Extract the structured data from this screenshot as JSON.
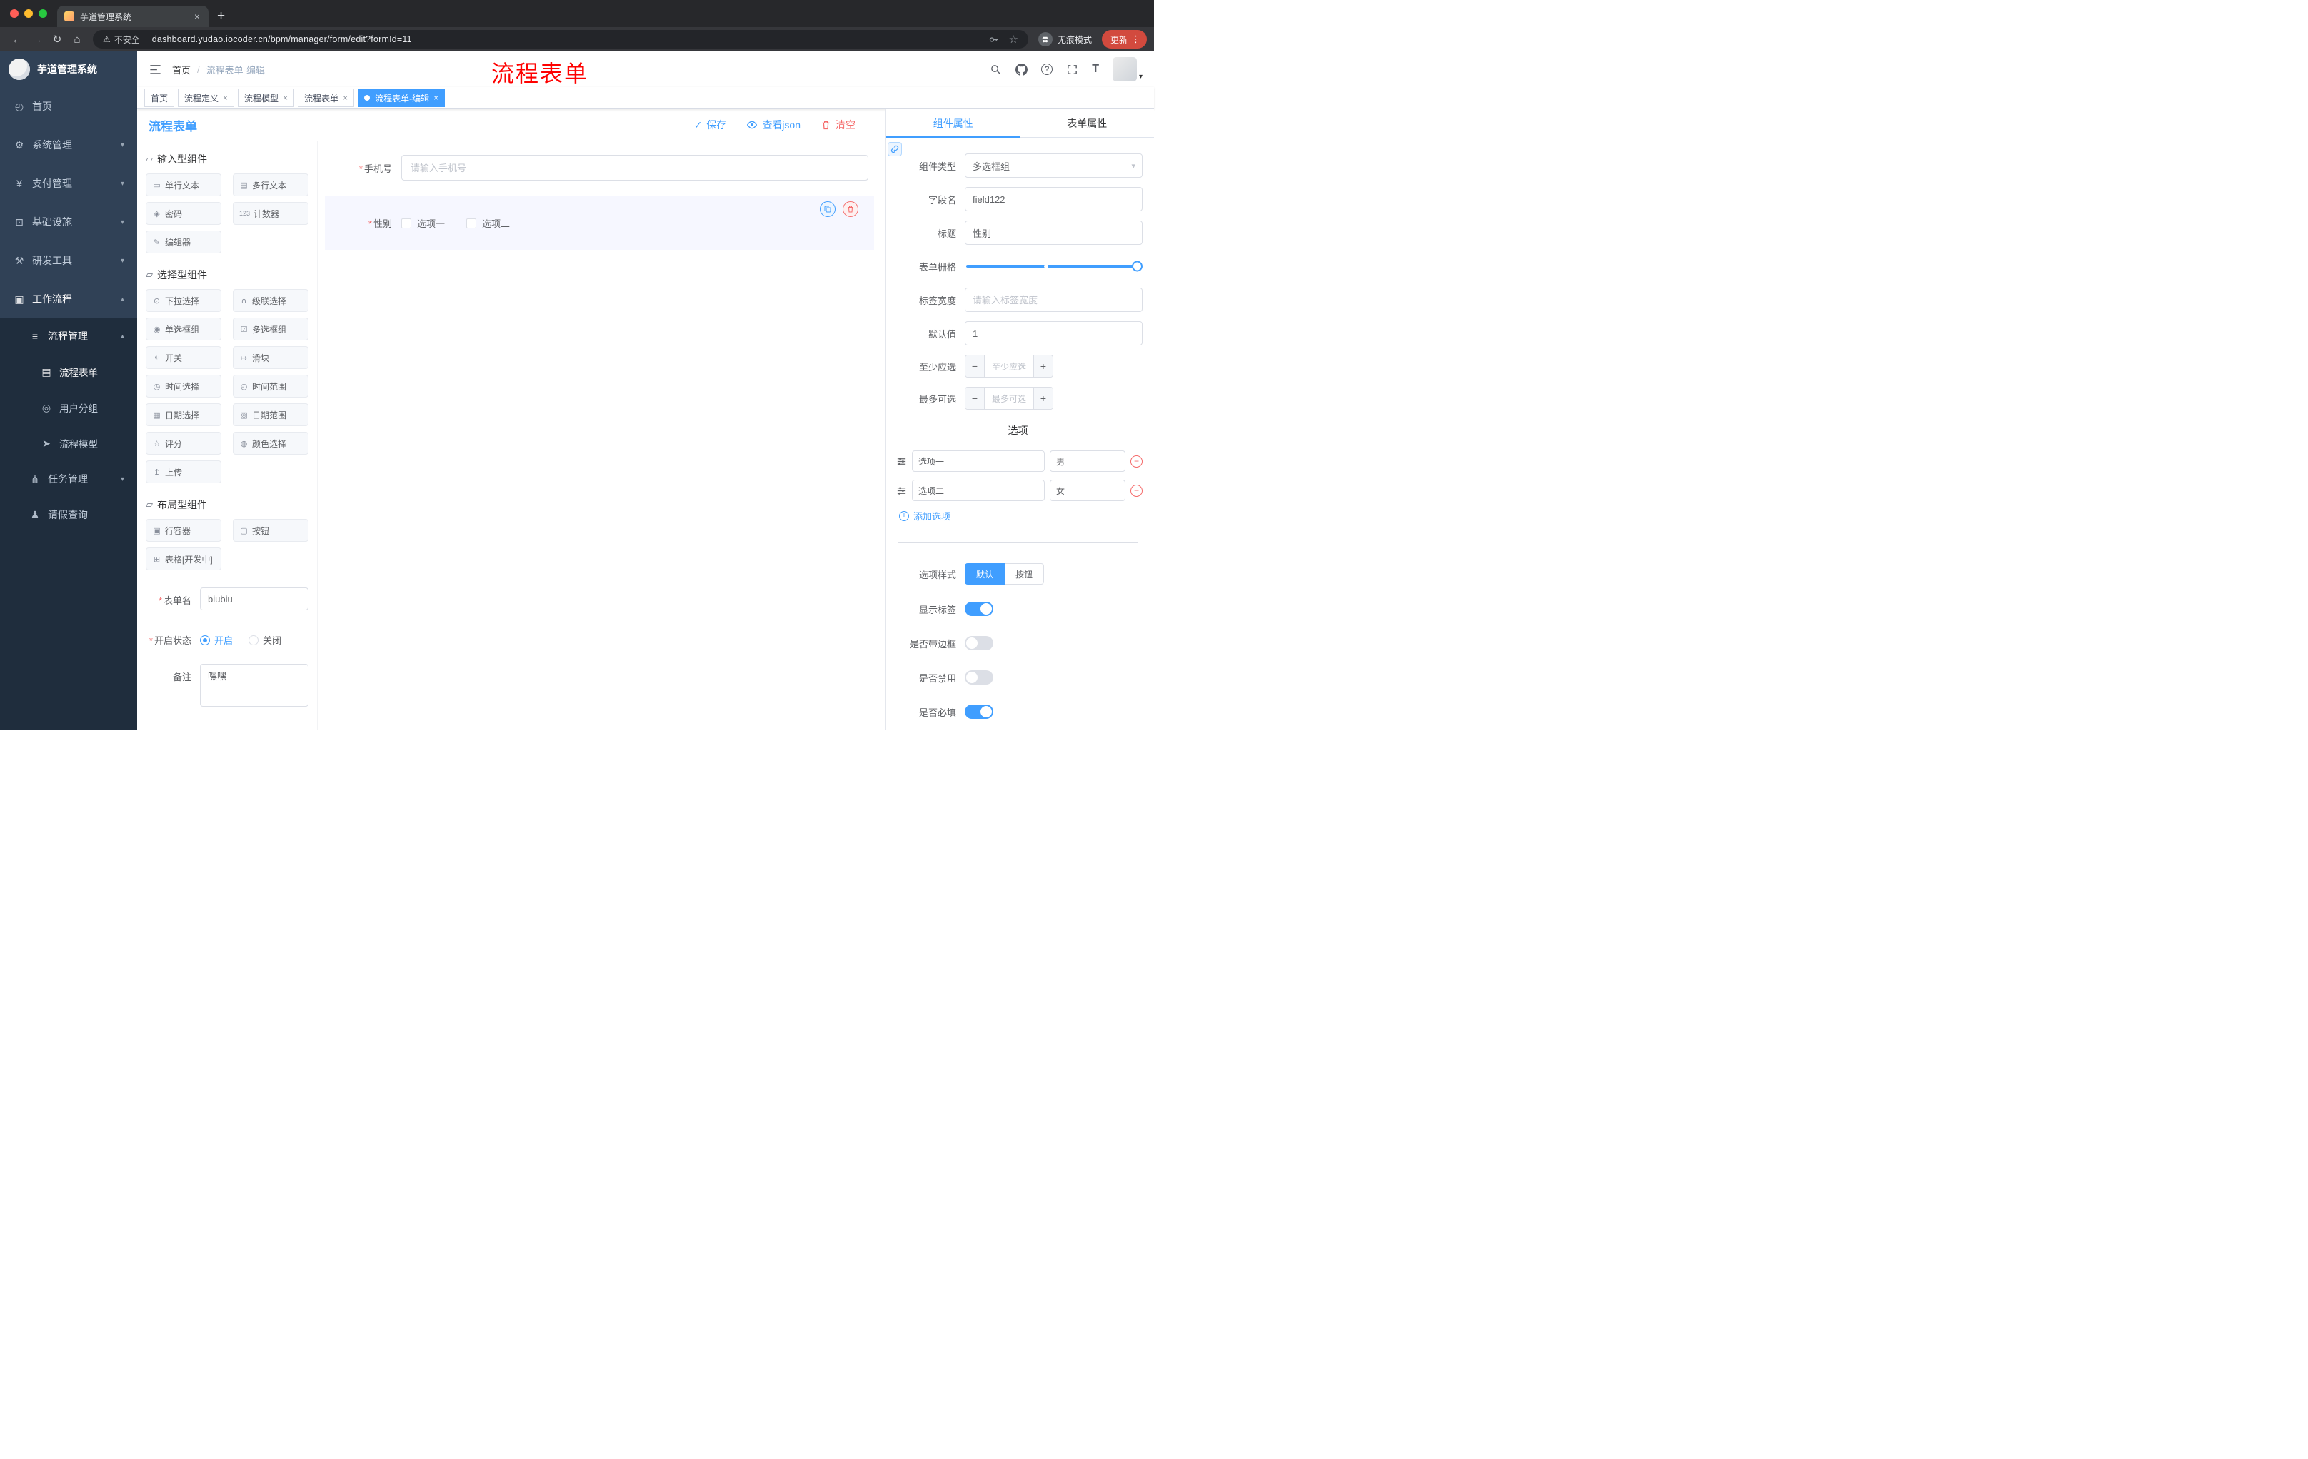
{
  "browser": {
    "tab_title": "芋道管理系统",
    "security_label": "不安全",
    "url": "dashboard.yudao.iocoder.cn/bpm/manager/form/edit?formId=11",
    "incognito_label": "无痕模式",
    "update_label": "更新"
  },
  "glyphs": {
    "close": "×",
    "new_tab": "+",
    "back": "←",
    "forward": "→",
    "reload": "↻",
    "home": "⌂",
    "warn": "⚠",
    "star": "☆",
    "dots": "⋮",
    "caret": "▾",
    "chev_down": "▾",
    "chev_up": "▴",
    "check": "✓",
    "slash": "/",
    "question": "?",
    "font_size": "T",
    "minus": "−",
    "plus": "+",
    "required": "*"
  },
  "annotation_text": "流程表单",
  "sidebar": {
    "logo_title": "芋道管理系统",
    "items": [
      {
        "label": "首页",
        "icon": "◴"
      },
      {
        "label": "系统管理",
        "icon": "⚙"
      },
      {
        "label": "支付管理",
        "icon": "¥"
      },
      {
        "label": "基础设施",
        "icon": "⊡"
      },
      {
        "label": "研发工具",
        "icon": "⚒"
      },
      {
        "label": "工作流程",
        "icon": "▣"
      },
      {
        "label": "流程管理",
        "icon": "≡"
      },
      {
        "label": "流程表单",
        "icon": "▤"
      },
      {
        "label": "用户分组",
        "icon": "◎"
      },
      {
        "label": "流程模型",
        "icon": "➤"
      },
      {
        "label": "任务管理",
        "icon": "⋔"
      },
      {
        "label": "请假查询",
        "icon": "♟"
      }
    ]
  },
  "header": {
    "breadcrumb_home": "首页",
    "breadcrumb_current": "流程表单-编辑"
  },
  "tags": [
    {
      "label": "首页"
    },
    {
      "label": "流程定义"
    },
    {
      "label": "流程模型"
    },
    {
      "label": "流程表单"
    },
    {
      "label": "流程表单-编辑"
    }
  ],
  "page": {
    "title": "流程表单",
    "save": "保存",
    "view_json": "查看json",
    "clear": "清空"
  },
  "components": {
    "groups": [
      {
        "title": "输入型组件",
        "items": [
          {
            "label": "单行文本",
            "icon": "▭"
          },
          {
            "label": "多行文本",
            "icon": "▤"
          },
          {
            "label": "密码",
            "icon": "◈"
          },
          {
            "label": "计数器",
            "icon": "123"
          },
          {
            "label": "编辑器",
            "icon": "✎"
          }
        ]
      },
      {
        "title": "选择型组件",
        "items": [
          {
            "label": "下拉选择",
            "icon": "⊙"
          },
          {
            "label": "级联选择",
            "icon": "⋔"
          },
          {
            "label": "单选框组",
            "icon": "◉"
          },
          {
            "label": "多选框组",
            "icon": "☑"
          },
          {
            "label": "开关",
            "icon": "◐"
          },
          {
            "label": "滑块",
            "icon": "↦"
          },
          {
            "label": "时间选择",
            "icon": "◷"
          },
          {
            "label": "时间范围",
            "icon": "◴"
          },
          {
            "label": "日期选择",
            "icon": "▦"
          },
          {
            "label": "日期范围",
            "icon": "▧"
          },
          {
            "label": "评分",
            "icon": "☆"
          },
          {
            "label": "颜色选择",
            "icon": "◍"
          },
          {
            "label": "上传",
            "icon": "↥"
          }
        ]
      },
      {
        "title": "布局型组件",
        "items": [
          {
            "label": "行容器",
            "icon": "▣"
          },
          {
            "label": "按钮",
            "icon": "▢"
          },
          {
            "label": "表格[开发中]",
            "icon": "⊞"
          }
        ]
      }
    ],
    "form": {
      "name_label": "表单名",
      "name_value": "biubiu",
      "status_label": "开启状态",
      "status_on": "开启",
      "status_off": "关闭",
      "remark_label": "备注",
      "remark_value": "嘿嘿"
    }
  },
  "canvas": {
    "phone": {
      "label": "手机号",
      "placeholder": "请输入手机号"
    },
    "gender": {
      "label": "性别",
      "option1": "选项一",
      "option2": "选项二"
    }
  },
  "props": {
    "tab_component": "组件属性",
    "tab_form": "表单属性",
    "rows": {
      "type_label": "组件类型",
      "type_value": "多选框组",
      "field_label": "字段名",
      "field_value": "field122",
      "title_label": "标题",
      "title_value": "性别",
      "grid_label": "表单栅格",
      "width_label": "标签宽度",
      "width_placeholder": "请输入标签宽度",
      "default_label": "默认值",
      "default_value": "1",
      "min_label": "至少应选",
      "min_placeholder": "至少应选",
      "max_label": "最多可选",
      "max_placeholder": "最多可选"
    },
    "options": {
      "divider_title": "选项",
      "list": [
        {
          "label": "选项一",
          "value": "男"
        },
        {
          "label": "选项二",
          "value": "女"
        }
      ],
      "add_label": "添加选项"
    },
    "style": {
      "style_label": "选项样式",
      "btn_default": "默认",
      "btn_button": "按钮",
      "show_label": "显示标签",
      "border_label": "是否带边框",
      "disabled_label": "是否禁用",
      "required_label": "是否必填"
    }
  }
}
